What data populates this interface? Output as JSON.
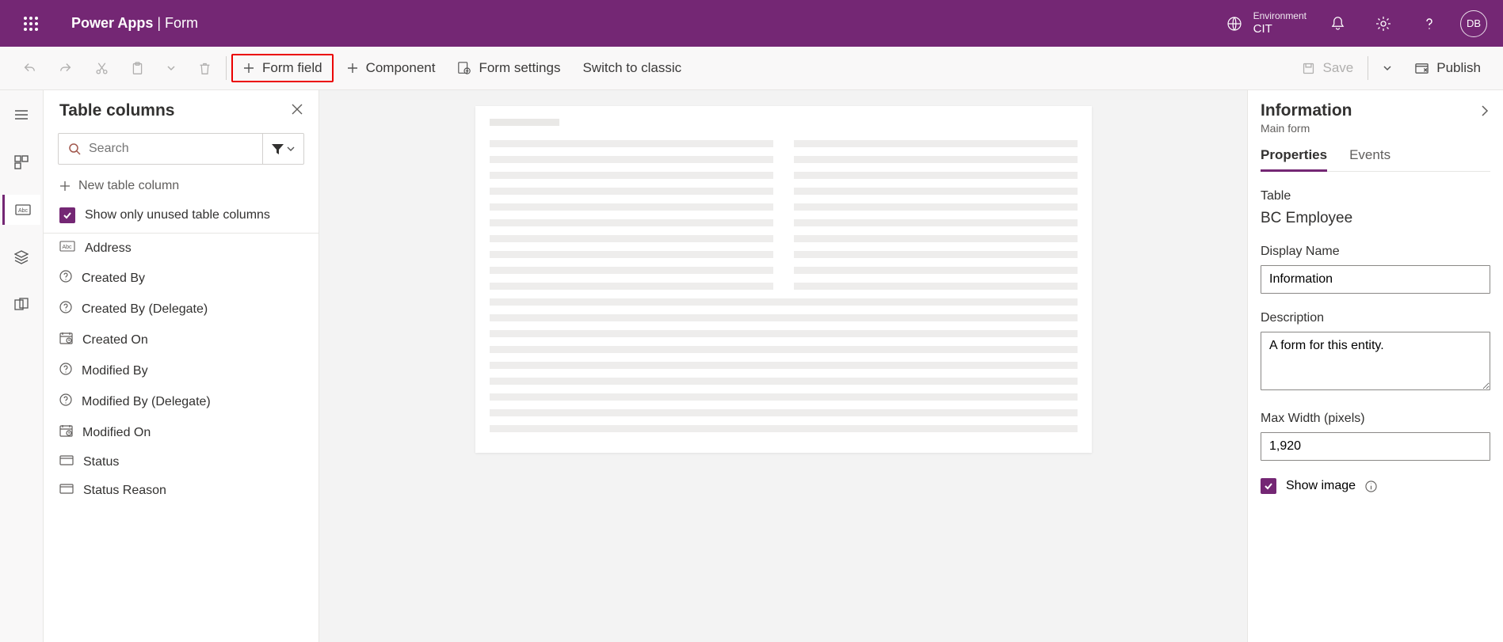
{
  "header": {
    "app_name": "Power Apps",
    "divider": "  |  ",
    "page": "Form",
    "env_label": "Environment",
    "env_name": "CIT",
    "avatar": "DB"
  },
  "cmd": {
    "form_field": "Form field",
    "component": "Component",
    "form_settings": "Form settings",
    "switch": "Switch to classic",
    "save": "Save",
    "publish": "Publish"
  },
  "columns_panel": {
    "title": "Table columns",
    "search_placeholder": "Search",
    "new_col": "New table column",
    "unused_chk": "Show only unused table columns",
    "items": [
      {
        "icon": "abc",
        "label": "Address"
      },
      {
        "icon": "q",
        "label": "Created By"
      },
      {
        "icon": "q",
        "label": "Created By (Delegate)"
      },
      {
        "icon": "cal",
        "label": "Created On"
      },
      {
        "icon": "q",
        "label": "Modified By"
      },
      {
        "icon": "q",
        "label": "Modified By (Delegate)"
      },
      {
        "icon": "cal",
        "label": "Modified On"
      },
      {
        "icon": "opt",
        "label": "Status"
      },
      {
        "icon": "opt",
        "label": "Status Reason"
      }
    ]
  },
  "props": {
    "title": "Information",
    "subtitle": "Main form",
    "tab_properties": "Properties",
    "tab_events": "Events",
    "table_label": "Table",
    "table_value": "BC Employee",
    "display_name_label": "Display Name",
    "display_name_value": "Information",
    "description_label": "Description",
    "description_value": "A form for this entity.",
    "maxwidth_label": "Max Width (pixels)",
    "maxwidth_value": "1,920",
    "showimage_label": "Show image"
  }
}
